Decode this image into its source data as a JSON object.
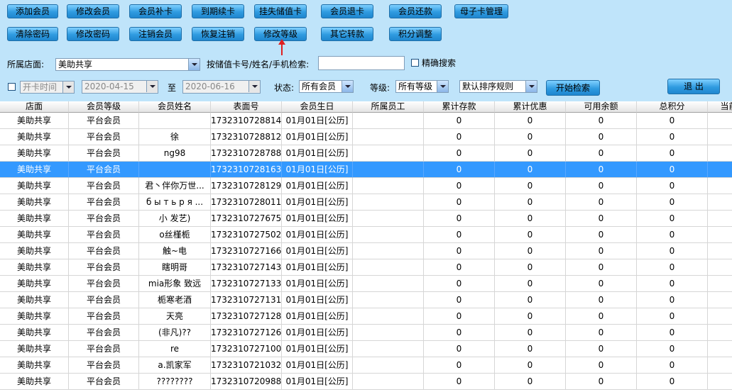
{
  "toolbar": {
    "row1": [
      "添加会员",
      "修改会员",
      "会员补卡",
      "到期续卡",
      "挂失储值卡",
      "会员退卡",
      "会员还款",
      "母子卡管理"
    ],
    "row2": [
      "清除密码",
      "修改密码",
      "注销会员",
      "恢复注销",
      "修改等级",
      "其它转款",
      "积分调整"
    ]
  },
  "filters": {
    "store_label": "所属店面:",
    "store_value": "美助共享",
    "search_label": "按储值卡号/姓名/手机检索:",
    "search_value": "",
    "exact_label": "精确搜索",
    "open_date_label": "开卡时间",
    "date_from": "2020-04-15",
    "date_to_label": "至",
    "date_to": "2020-06-16",
    "status_label": "状态:",
    "status_value": "所有会员",
    "level_label": "等级:",
    "level_value": "所有等级",
    "sort_value": "默认排序规则",
    "search_button": "开始检索",
    "exit_button": "退 出"
  },
  "table": {
    "columns": [
      "店面",
      "会员等级",
      "会员姓名",
      "表面号",
      "会员生日",
      "所属员工",
      "累计存款",
      "累计优惠",
      "可用余额",
      "总积分",
      "当前"
    ],
    "rows": [
      [
        "美助共享",
        "平台会员",
        "",
        "1732310728814",
        "01月01日[公历]",
        "",
        "0",
        "0",
        "0",
        "0"
      ],
      [
        "美助共享",
        "平台会员",
        "徐",
        "1732310728812",
        "01月01日[公历]",
        "",
        "0",
        "0",
        "0",
        "0"
      ],
      [
        "美助共享",
        "平台会员",
        "ng98",
        "1732310728788",
        "01月01日[公历]",
        "",
        "0",
        "0",
        "0",
        "0"
      ],
      [
        "美助共享",
        "平台会员",
        "",
        "1732310728163",
        "01月01日[公历]",
        "",
        "0",
        "0",
        "0",
        "0"
      ],
      [
        "美助共享",
        "平台会员",
        "君丶伴你万世...",
        "1732310728129",
        "01月01日[公历]",
        "",
        "0",
        "0",
        "0",
        "0"
      ],
      [
        "美助共享",
        "平台会员",
        "б ы т ь р я ...",
        "1732310728011",
        "01月01日[公历]",
        "",
        "0",
        "0",
        "0",
        "0"
      ],
      [
        "美助共享",
        "平台会员",
        "小  发艺)",
        "1732310727675",
        "01月01日[公历]",
        "",
        "0",
        "0",
        "0",
        "0"
      ],
      [
        "美助共享",
        "平台会员",
        "o丝槿栀",
        "1732310727502",
        "01月01日[公历]",
        "",
        "0",
        "0",
        "0",
        "0"
      ],
      [
        "美助共享",
        "平台会员",
        "触~电",
        "1732310727166",
        "01月01日[公历]",
        "",
        "0",
        "0",
        "0",
        "0"
      ],
      [
        "美助共享",
        "平台会员",
        "瞎明哥",
        "1732310727143",
        "01月01日[公历]",
        "",
        "0",
        "0",
        "0",
        "0"
      ],
      [
        "美助共享",
        "平台会员",
        "mia形象  致远",
        "1732310727133",
        "01月01日[公历]",
        "",
        "0",
        "0",
        "0",
        "0"
      ],
      [
        "美助共享",
        "平台会员",
        "栀寒老酒",
        "1732310727131",
        "01月01日[公历]",
        "",
        "0",
        "0",
        "0",
        "0"
      ],
      [
        "美助共享",
        "平台会员",
        "天亮",
        "1732310727128",
        "01月01日[公历]",
        "",
        "0",
        "0",
        "0",
        "0"
      ],
      [
        "美助共享",
        "平台会员",
        "(非凡)??",
        "1732310727126",
        "01月01日[公历]",
        "",
        "0",
        "0",
        "0",
        "0"
      ],
      [
        "美助共享",
        "平台会员",
        "re",
        "1732310727100",
        "01月01日[公历]",
        "",
        "0",
        "0",
        "0",
        "0"
      ],
      [
        "美助共享",
        "平台会员",
        "a.凯家军",
        "1732310721032",
        "01月01日[公历]",
        "",
        "0",
        "0",
        "0",
        "0"
      ],
      [
        "美助共享",
        "平台会员",
        "????????",
        "1732310720988",
        "01月01日[公历]",
        "",
        "0",
        "0",
        "0",
        "0"
      ]
    ],
    "selected_row": 3
  },
  "colors": {
    "background": "#bfe4fa",
    "button": "#2f9be0",
    "selection": "#3399ff",
    "arrow": "#e02020"
  }
}
